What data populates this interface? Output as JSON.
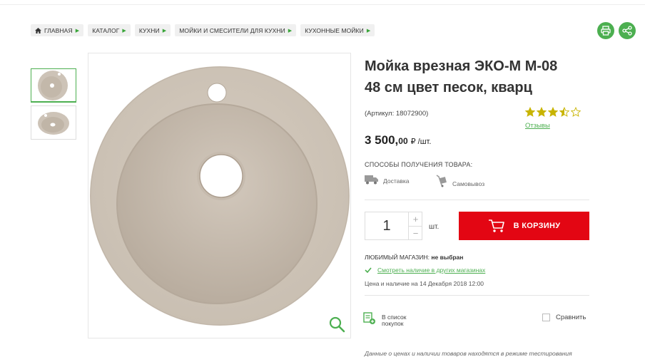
{
  "breadcrumbs": [
    "ГЛАВНАЯ",
    "КАТАЛОГ",
    "КУХНИ",
    "МОЙКИ И СМЕСИТЕЛИ ДЛЯ КУХНИ",
    "КУХОННЫЕ МОЙКИ"
  ],
  "product": {
    "title_line1": "Мойка врезная ЭКО-М М-08",
    "title_line2": "48 см цвет песок, кварц",
    "article": "(Артикул: 18072900)",
    "rating": 3.5,
    "rating_max": 5,
    "reviews_link": "Отзывы",
    "price_int": "3 500,",
    "price_cents": "00",
    "price_unit": "₽ /шт."
  },
  "delivery": {
    "heading": "СПОСОБЫ ПОЛУЧЕНИЯ ТОВАРА:",
    "options": [
      "Доставка",
      "Самовывоз"
    ]
  },
  "purchase": {
    "quantity": "1",
    "plus": "+",
    "minus": "−",
    "unit": "шт.",
    "cart_label": "В КОРЗИНУ"
  },
  "store": {
    "label": "ЛЮБИМЫЙ МАГАЗИН:",
    "value": "не выбран",
    "availability_link": "Смотреть наличие в других магазинах",
    "price_date": "Цена и наличие на 14 Декабря 2018 12:00"
  },
  "actions": {
    "wishlist_line1": "В список",
    "wishlist_line2": "покупок",
    "compare": "Сравнить"
  },
  "footer_note": "Данные о ценах и наличии товаров находятся в режиме тестирования",
  "colors": {
    "accent_green": "#4caf50",
    "cart_red": "#e30613",
    "sink_sand": "#cdc3b7",
    "star_gold": "#c8b400"
  },
  "icons": [
    "home-icon",
    "print-icon",
    "share-icon",
    "zoom-icon",
    "truck-icon",
    "cart-trolley-icon",
    "check-icon",
    "wishlist-icon",
    "star-icon"
  ]
}
